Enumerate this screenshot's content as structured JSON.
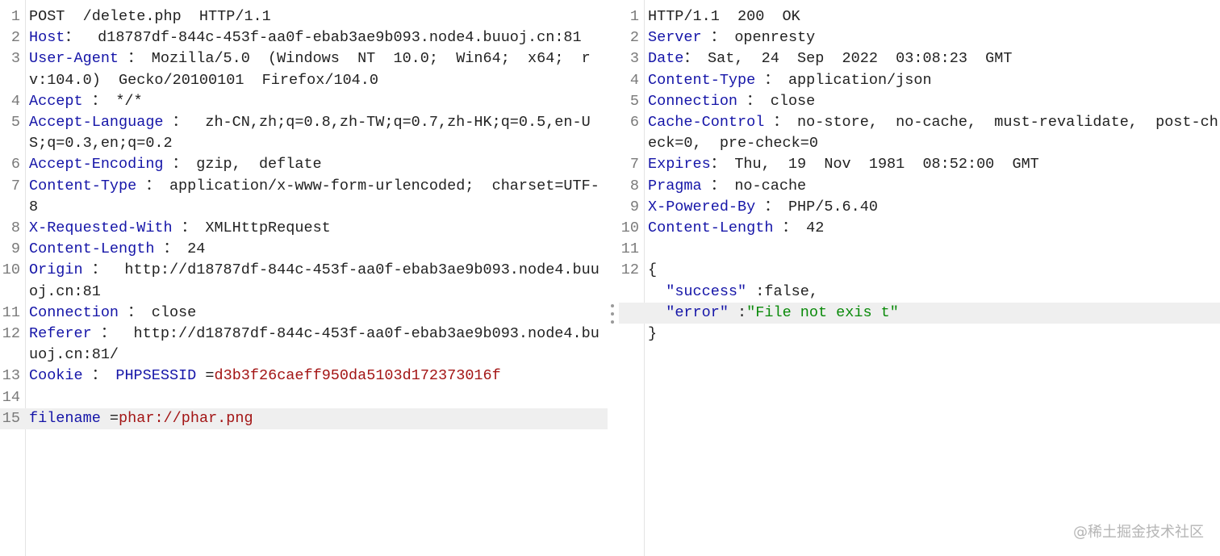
{
  "request": {
    "lines": [
      {
        "n": "1",
        "parts": [
          {
            "t": "POST  /delete.php  HTTP/1.1",
            "c": "v"
          }
        ]
      },
      {
        "n": "2",
        "parts": [
          {
            "t": "Host",
            "c": "k"
          },
          {
            "t": "：  d18787df-844c-453f-aa0f-ebab3ae9b093.node4.buuoj.cn:81",
            "c": "v"
          }
        ]
      },
      {
        "n": "3",
        "parts": [
          {
            "t": "User-Agent",
            "c": "k"
          },
          {
            "t": " ： Mozilla/5.0  (Windows  NT  10.0;  Win64;  x64;  rv:104.0)  Gecko/20100101  Firefox/104.0",
            "c": "v"
          }
        ]
      },
      {
        "n": "4",
        "parts": [
          {
            "t": "Accept",
            "c": "k"
          },
          {
            "t": " ： */*",
            "c": "v"
          }
        ]
      },
      {
        "n": "5",
        "parts": [
          {
            "t": "Accept-Language",
            "c": "k"
          },
          {
            "t": " ：  zh-CN,zh;q=0.8,zh-TW;q=0.7,zh-HK;q=0.5,en-US;q=0.3,en;q=0.2",
            "c": "v"
          }
        ]
      },
      {
        "n": "6",
        "parts": [
          {
            "t": "Accept-Encoding",
            "c": "k"
          },
          {
            "t": " ： gzip,  deflate",
            "c": "v"
          }
        ]
      },
      {
        "n": "7",
        "parts": [
          {
            "t": "Content-Type",
            "c": "k"
          },
          {
            "t": " ： application/x-www-form-urlencoded;  charset=UTF-8",
            "c": "v"
          }
        ]
      },
      {
        "n": "8",
        "parts": [
          {
            "t": "X-Requested-With",
            "c": "k"
          },
          {
            "t": " ： XMLHttpRequest",
            "c": "v"
          }
        ]
      },
      {
        "n": "9",
        "parts": [
          {
            "t": "Content-Length",
            "c": "k"
          },
          {
            "t": " ： 24",
            "c": "v"
          }
        ]
      },
      {
        "n": "10",
        "parts": [
          {
            "t": "Origin",
            "c": "k"
          },
          {
            "t": " ：  http://d18787df-844c-453f-aa0f-ebab3ae9b093.node4.buuoj.cn:81",
            "c": "v"
          }
        ]
      },
      {
        "n": "11",
        "parts": [
          {
            "t": "Connection",
            "c": "k"
          },
          {
            "t": " ： close",
            "c": "v"
          }
        ]
      },
      {
        "n": "12",
        "parts": [
          {
            "t": "Referer",
            "c": "k"
          },
          {
            "t": " ：  http://d18787df-844c-453f-aa0f-ebab3ae9b093.node4.buuoj.cn:81/",
            "c": "v"
          }
        ]
      },
      {
        "n": "13",
        "parts": [
          {
            "t": "Cookie",
            "c": "k"
          },
          {
            "t": " ： ",
            "c": "v"
          },
          {
            "t": "PHPSESSID",
            "c": "k"
          },
          {
            "t": " =",
            "c": "v"
          },
          {
            "t": "d3b3f26caeff950da5103d172373016f",
            "c": "cv"
          }
        ]
      },
      {
        "n": "14",
        "parts": []
      },
      {
        "n": "15",
        "hl": true,
        "parts": [
          {
            "t": "filename",
            "c": "k"
          },
          {
            "t": " =",
            "c": "v"
          },
          {
            "t": "phar://phar.png",
            "c": "cv"
          }
        ]
      }
    ]
  },
  "response": {
    "lines": [
      {
        "n": "1",
        "parts": [
          {
            "t": "HTTP/1.1  200  OK",
            "c": "v"
          }
        ]
      },
      {
        "n": "2",
        "parts": [
          {
            "t": "Server",
            "c": "k"
          },
          {
            "t": " ： openresty",
            "c": "v"
          }
        ]
      },
      {
        "n": "3",
        "parts": [
          {
            "t": "Date",
            "c": "k"
          },
          {
            "t": "： Sat,  24  Sep  2022  03:08:23  GMT",
            "c": "v"
          }
        ]
      },
      {
        "n": "4",
        "parts": [
          {
            "t": "Content-Type",
            "c": "k"
          },
          {
            "t": " ： application/json",
            "c": "v"
          }
        ]
      },
      {
        "n": "5",
        "parts": [
          {
            "t": "Connection",
            "c": "k"
          },
          {
            "t": " ： close",
            "c": "v"
          }
        ]
      },
      {
        "n": "6",
        "parts": [
          {
            "t": "Cache-Control",
            "c": "k"
          },
          {
            "t": " ： no-store,  no-cache,  must-revalidate,  post-check=0,  pre-check=0",
            "c": "v"
          }
        ]
      },
      {
        "n": "7",
        "parts": [
          {
            "t": "Expires",
            "c": "k"
          },
          {
            "t": "： Thu,  19  Nov  1981  08:52:00  GMT",
            "c": "v"
          }
        ]
      },
      {
        "n": "8",
        "parts": [
          {
            "t": "Pragma",
            "c": "k"
          },
          {
            "t": " ： no-cache",
            "c": "v"
          }
        ]
      },
      {
        "n": "9",
        "parts": [
          {
            "t": "X-Powered-By",
            "c": "k"
          },
          {
            "t": " ： PHP/5.6.40",
            "c": "v"
          }
        ]
      },
      {
        "n": "10",
        "parts": [
          {
            "t": "Content-Length",
            "c": "k"
          },
          {
            "t": " ： 42",
            "c": "v"
          }
        ]
      },
      {
        "n": "11",
        "parts": []
      },
      {
        "n": "12",
        "parts": [
          {
            "t": "{",
            "c": "p"
          }
        ]
      },
      {
        "n": "",
        "parts": [
          {
            "t": "  ",
            "c": "p"
          },
          {
            "t": "\"success\"",
            "c": "jk"
          },
          {
            "t": " :false,",
            "c": "p"
          }
        ]
      },
      {
        "n": "",
        "hl": true,
        "parts": [
          {
            "t": "  ",
            "c": "p"
          },
          {
            "t": "\"error\"",
            "c": "jk"
          },
          {
            "t": " :",
            "c": "p"
          },
          {
            "t": "\"File not exis t\"",
            "c": "s"
          }
        ]
      },
      {
        "n": "",
        "parts": [
          {
            "t": "}",
            "c": "p"
          }
        ]
      }
    ]
  },
  "watermark": "@稀土掘金技术社区"
}
